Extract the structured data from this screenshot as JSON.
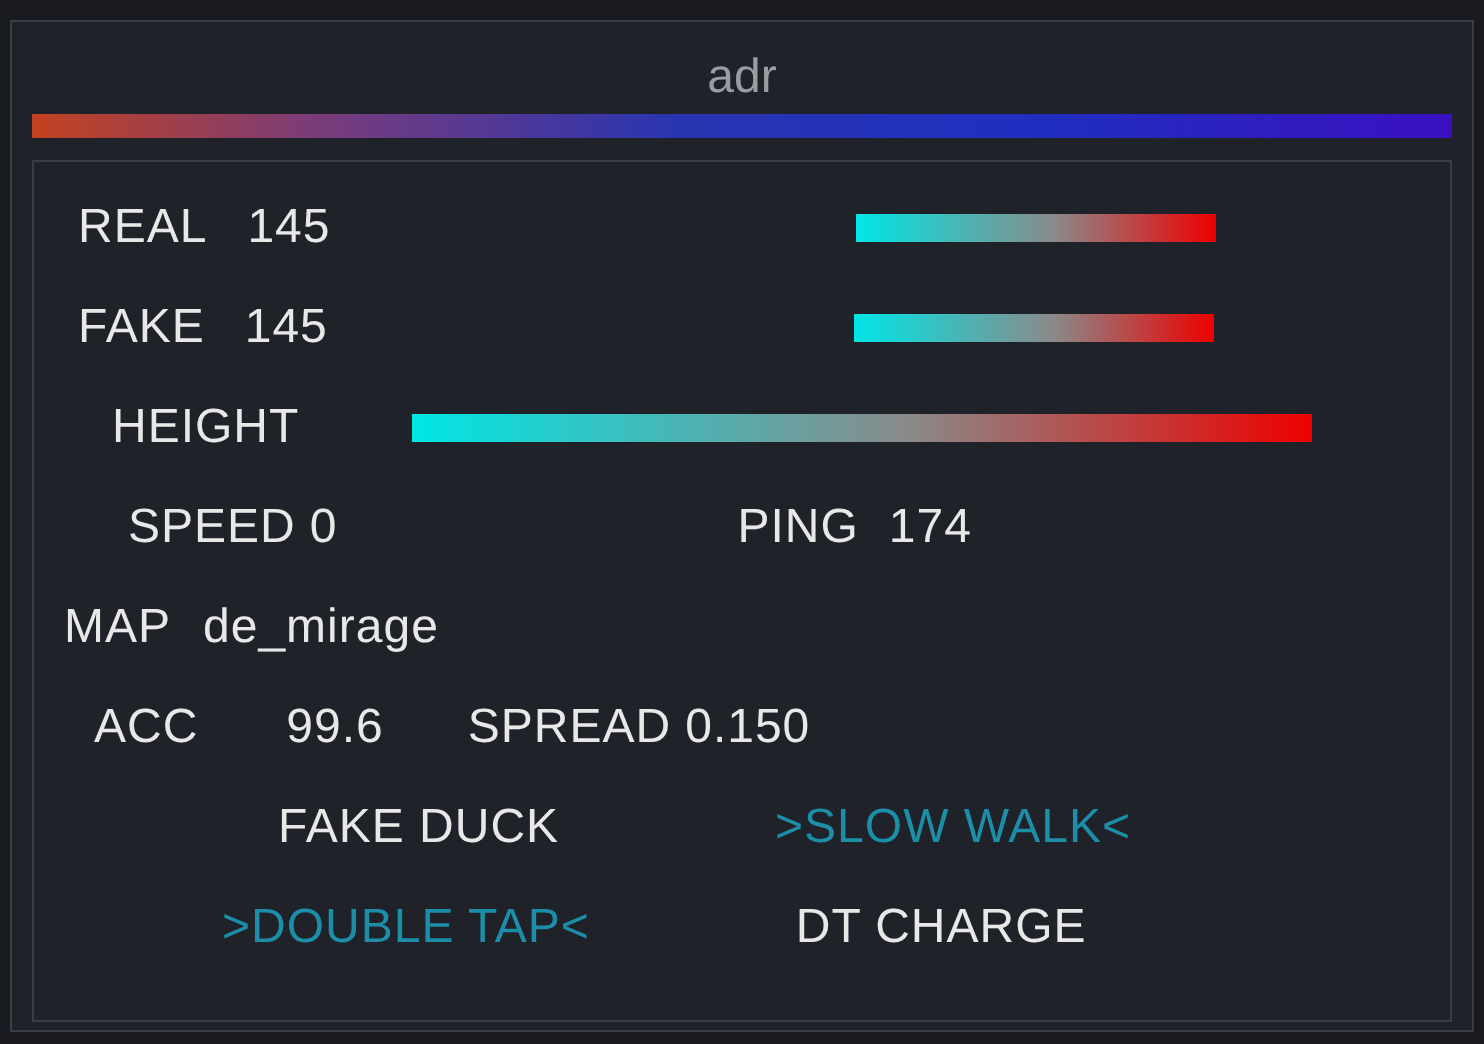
{
  "title": "adr",
  "real": {
    "label": "REAL",
    "value": "145"
  },
  "fake": {
    "label": "FAKE",
    "value": "145"
  },
  "height": {
    "label": "HEIGHT"
  },
  "speed": {
    "label": "SPEED",
    "value": "0"
  },
  "ping": {
    "label": "PING",
    "value": "174"
  },
  "map": {
    "label": "MAP",
    "value": "de_mirage"
  },
  "acc": {
    "label": "ACC",
    "value": "99.6"
  },
  "spread": {
    "label": "SPREAD",
    "value": "0.150"
  },
  "toggles": [
    {
      "label": "FAKE DUCK",
      "active": false
    },
    {
      "label": ">SLOW WALK<",
      "active": true
    },
    {
      "label": ">DOUBLE TAP<",
      "active": true
    },
    {
      "label": "DT CHARGE",
      "active": false
    }
  ]
}
